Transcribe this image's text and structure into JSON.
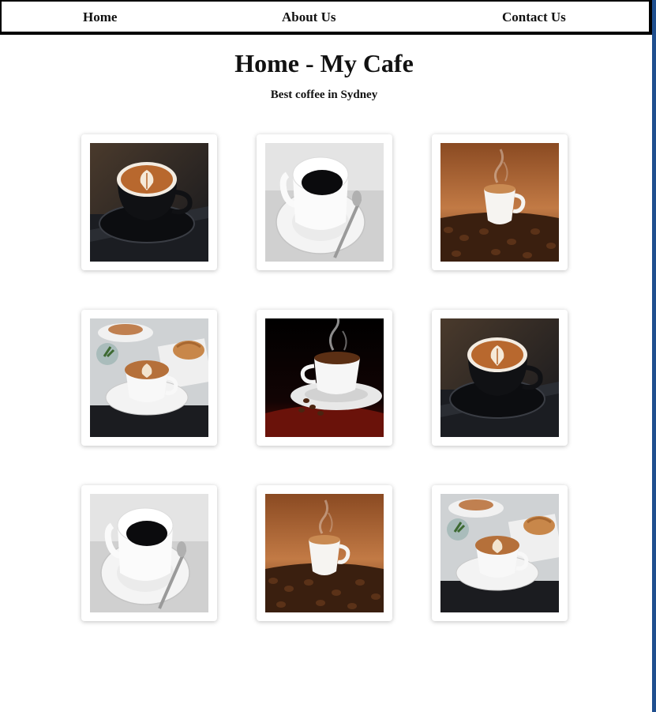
{
  "nav": {
    "items": [
      {
        "label": "Home"
      },
      {
        "label": "About Us"
      },
      {
        "label": "Contact Us"
      }
    ]
  },
  "header": {
    "title": "Home - My Cafe",
    "subtitle": "Best coffee in Sydney"
  },
  "gallery": {
    "images": [
      {
        "kind": "latte-dark-cup"
      },
      {
        "kind": "black-coffee-white-cup"
      },
      {
        "kind": "espresso-on-beans"
      },
      {
        "kind": "latte-with-pastry"
      },
      {
        "kind": "steaming-cup-dark"
      },
      {
        "kind": "latte-dark-cup"
      },
      {
        "kind": "black-coffee-white-cup"
      },
      {
        "kind": "espresso-on-beans"
      },
      {
        "kind": "latte-with-pastry"
      }
    ]
  },
  "colors": {
    "accent_edge": "#1f4f8f",
    "text": "#111111"
  }
}
